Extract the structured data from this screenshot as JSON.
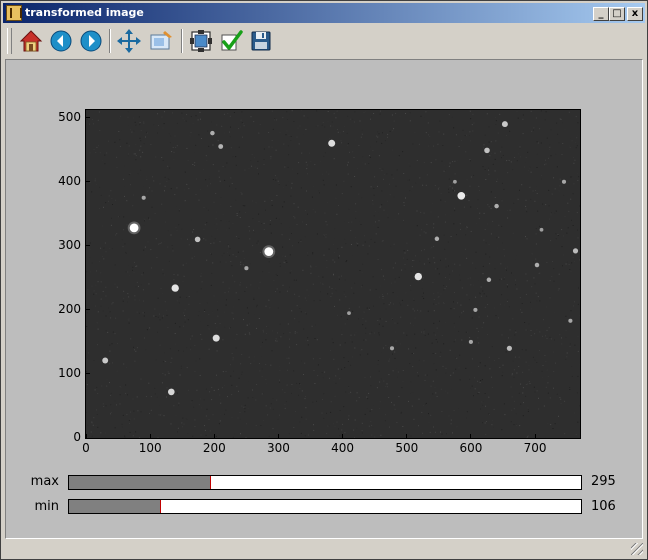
{
  "window": {
    "title": "transformed image"
  },
  "titlebar_buttons": {
    "minimize": "_",
    "maximize": "□",
    "close": "x"
  },
  "toolbar": {
    "tools": [
      {
        "name": "home-icon"
      },
      {
        "name": "back-icon"
      },
      {
        "name": "forward-icon"
      },
      {
        "name": "pan-icon"
      },
      {
        "name": "zoom-icon"
      },
      {
        "name": "configure-subplots-icon"
      },
      {
        "name": "check-icon"
      },
      {
        "name": "save-icon"
      }
    ]
  },
  "chart_data": {
    "type": "image",
    "xlim": [
      0,
      770
    ],
    "ylim": [
      0,
      512
    ],
    "xticks": [
      "0",
      "100",
      "200",
      "300",
      "400",
      "500",
      "600",
      "700"
    ],
    "yticks": [
      "0",
      "100",
      "200",
      "300",
      "400",
      "500"
    ],
    "colormap": "gray",
    "stars": [
      {
        "x": 75,
        "y": 328,
        "brightness": 1.0
      },
      {
        "x": 285,
        "y": 291,
        "brightness": 1.0
      },
      {
        "x": 139,
        "y": 234,
        "brightness": 0.8
      },
      {
        "x": 518,
        "y": 252,
        "brightness": 0.8
      },
      {
        "x": 585,
        "y": 378,
        "brightness": 0.85
      },
      {
        "x": 383,
        "y": 460,
        "brightness": 0.75
      },
      {
        "x": 203,
        "y": 156,
        "brightness": 0.75
      },
      {
        "x": 133,
        "y": 72,
        "brightness": 0.7
      },
      {
        "x": 30,
        "y": 121,
        "brightness": 0.6
      },
      {
        "x": 174,
        "y": 310,
        "brightness": 0.55
      },
      {
        "x": 625,
        "y": 449,
        "brightness": 0.55
      },
      {
        "x": 653,
        "y": 490,
        "brightness": 0.6
      },
      {
        "x": 660,
        "y": 140,
        "brightness": 0.5
      },
      {
        "x": 763,
        "y": 292,
        "brightness": 0.5
      },
      {
        "x": 628,
        "y": 247,
        "brightness": 0.4
      },
      {
        "x": 210,
        "y": 455,
        "brightness": 0.45
      },
      {
        "x": 197,
        "y": 476,
        "brightness": 0.4
      },
      {
        "x": 547,
        "y": 311,
        "brightness": 0.4
      },
      {
        "x": 607,
        "y": 200,
        "brightness": 0.35
      },
      {
        "x": 703,
        "y": 270,
        "brightness": 0.4
      },
      {
        "x": 755,
        "y": 183,
        "brightness": 0.35
      },
      {
        "x": 640,
        "y": 362,
        "brightness": 0.4
      },
      {
        "x": 477,
        "y": 140,
        "brightness": 0.35
      },
      {
        "x": 600,
        "y": 150,
        "brightness": 0.35
      },
      {
        "x": 745,
        "y": 400,
        "brightness": 0.35
      },
      {
        "x": 90,
        "y": 375,
        "brightness": 0.35
      },
      {
        "x": 250,
        "y": 265,
        "brightness": 0.35
      },
      {
        "x": 410,
        "y": 195,
        "brightness": 0.3
      },
      {
        "x": 575,
        "y": 400,
        "brightness": 0.3
      },
      {
        "x": 710,
        "y": 325,
        "brightness": 0.3
      }
    ]
  },
  "sliders": {
    "max": {
      "label": "max",
      "value": "295",
      "fill_fraction": 0.278
    },
    "min": {
      "label": "min",
      "value": "106",
      "fill_fraction": 0.18
    }
  }
}
